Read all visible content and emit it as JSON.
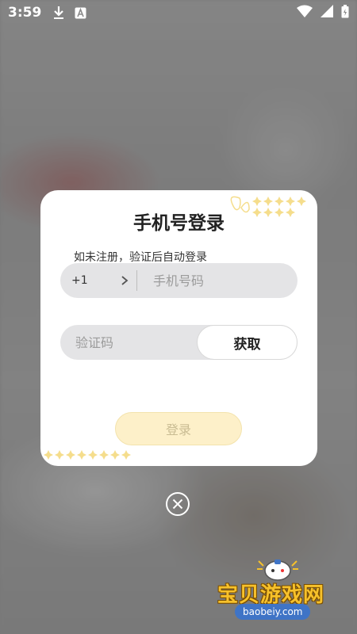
{
  "status_bar": {
    "time": "3:59",
    "icons": [
      "download-icon",
      "a-badge-icon",
      "wifi-icon",
      "signal-icon",
      "battery-icon"
    ]
  },
  "dialog": {
    "title": "手机号登录",
    "hint": "如未注册，验证后自动登录",
    "country_code": "+1",
    "phone_placeholder": "手机号码",
    "code_placeholder": "验证码",
    "get_code_label": "获取",
    "login_label": "登录"
  },
  "watermark": {
    "brand": "宝贝游戏网",
    "url": "baobeiy.com"
  },
  "colors": {
    "login_bg": "#fdf0c9",
    "login_text": "#c9bc93",
    "deco": "#f5dd8c",
    "field_bg": "#e4e4e6"
  }
}
